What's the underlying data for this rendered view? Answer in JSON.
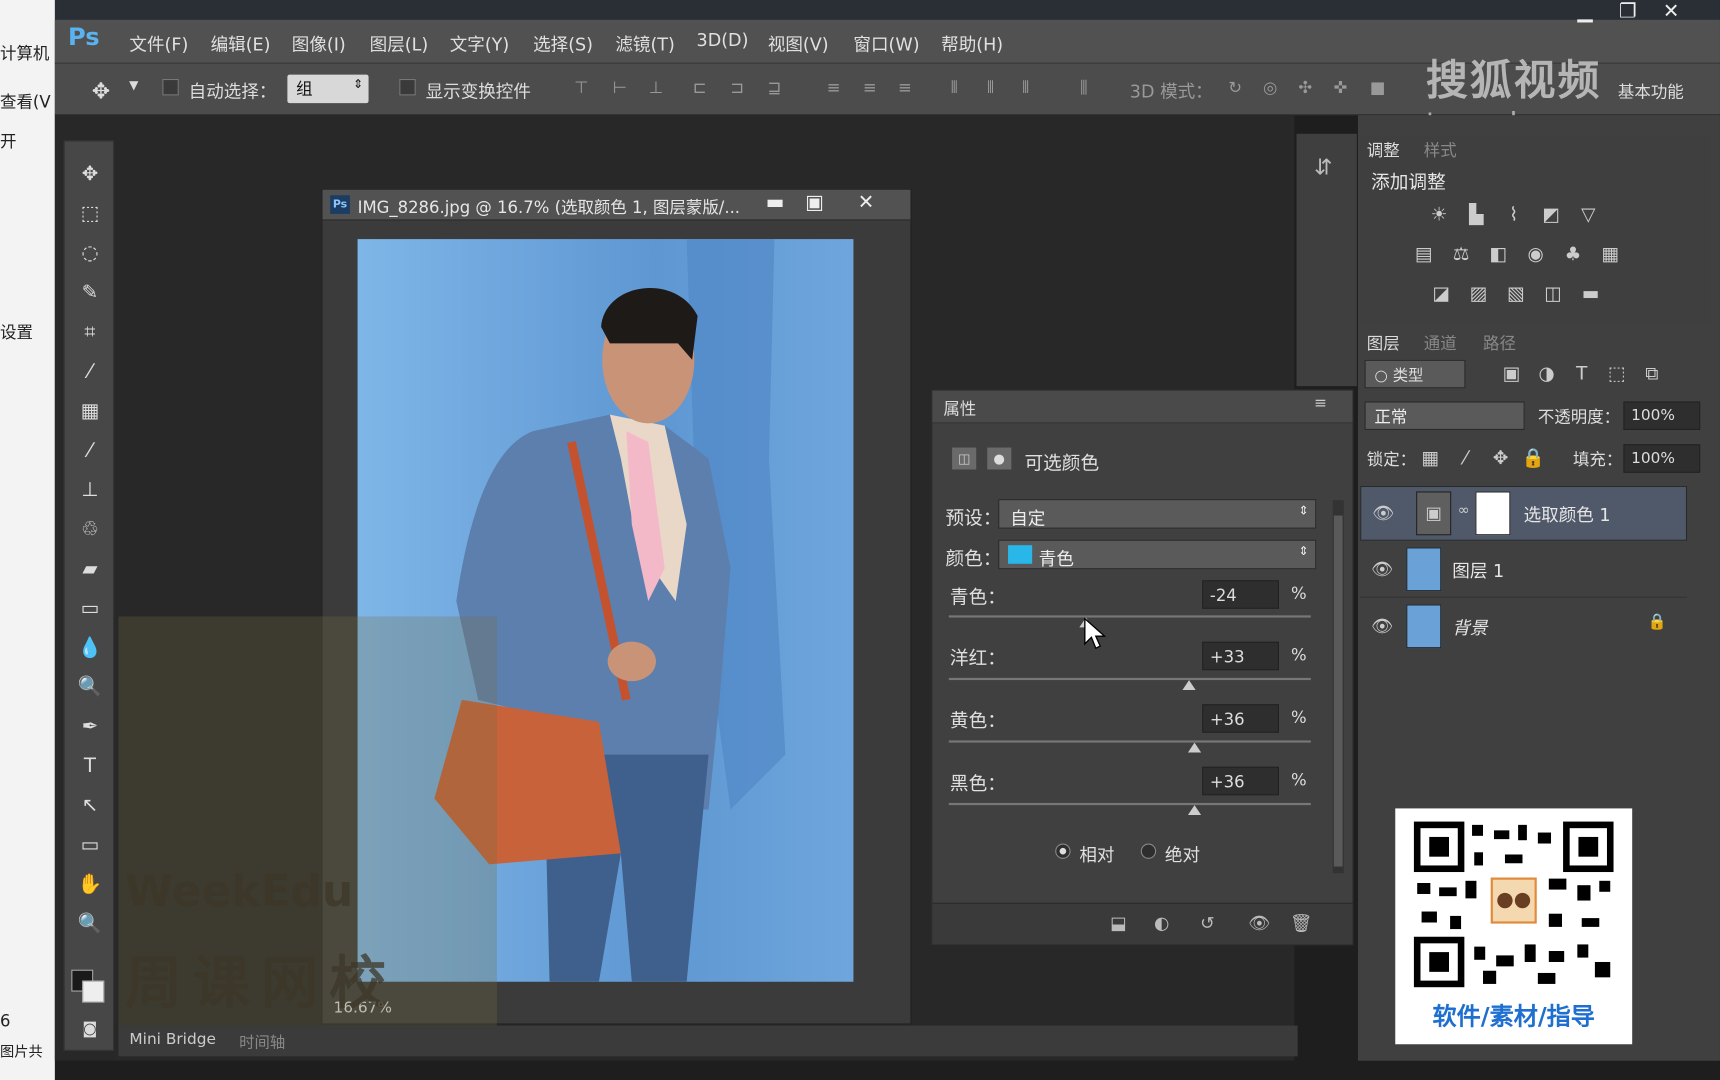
{
  "background_window": {
    "items": [
      "计算机",
      "查看(V",
      "开",
      "设置",
      "6",
      "图片共"
    ]
  },
  "menubar": {
    "logo": "Ps",
    "items": [
      "文件(F)",
      "编辑(E)",
      "图像(I)",
      "图层(L)",
      "文字(Y)",
      "选择(S)",
      "滤镜(T)",
      "3D(D)",
      "视图(V)",
      "窗口(W)",
      "帮助(H)"
    ]
  },
  "options": {
    "auto_select_label": "自动选择：",
    "auto_select_value": "组",
    "show_transform_label": "显示变换控件",
    "mode_3d_label": "3D 模式：",
    "workspace_label": "基本功能"
  },
  "watermark": {
    "line1": "搜狐视频",
    "line2": "tv.sohu.com",
    "weekedu1": "WeekEdu",
    "weekedu2": "周课网校"
  },
  "document": {
    "title": "IMG_8286.jpg @ 16.7% (选取颜色 1, 图层蒙版/...",
    "zoom": "16.67%",
    "status_tabs": [
      "Mini Bridge",
      "时间轴"
    ]
  },
  "adjustments": {
    "tabs": [
      "调整",
      "样式"
    ],
    "title": "添加调整"
  },
  "layers_panel": {
    "tabs": [
      "图层",
      "通道",
      "路径"
    ],
    "filter_label": "类型",
    "blend_mode": "正常",
    "opacity_label": "不透明度：",
    "opacity_value": "100%",
    "lock_label": "锁定：",
    "fill_label": "填充：",
    "fill_value": "100%",
    "layers": [
      {
        "name": "选取颜色 1",
        "selected": true
      },
      {
        "name": "图层 1",
        "selected": false
      },
      {
        "name": "背景",
        "selected": false,
        "locked": true
      }
    ]
  },
  "properties": {
    "tab": "属性",
    "title": "可选颜色",
    "preset_label": "预设：",
    "preset_value": "自定",
    "color_label": "颜色：",
    "color_value": "青色",
    "color_swatch": "#29b6e8",
    "sliders": [
      {
        "label": "青色：",
        "value": "-24",
        "unit": "%",
        "level": -24
      },
      {
        "label": "洋红：",
        "value": "+33",
        "unit": "%",
        "level": 33
      },
      {
        "label": "黄色：",
        "value": "+36",
        "unit": "%",
        "level": 36
      },
      {
        "label": "黑色：",
        "value": "+36",
        "unit": "%",
        "level": 36
      }
    ],
    "method_relative": "相对",
    "method_absolute": "绝对"
  },
  "qr": {
    "caption": "软件/素材/指导"
  },
  "colors": {
    "accent": "#5ab3f0",
    "panel": "#404040",
    "selected_layer": "#50596a"
  }
}
